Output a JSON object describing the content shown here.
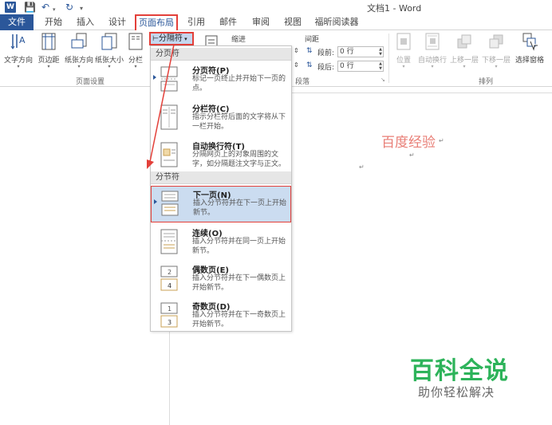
{
  "title_bar": {
    "app_logo": "W",
    "doc_title": "文档1 - Word"
  },
  "tabs": [
    "文件",
    "开始",
    "插入",
    "设计",
    "页面布局",
    "引用",
    "邮件",
    "审阅",
    "视图",
    "福昕阅读器"
  ],
  "ribbon": {
    "page_setup": {
      "buttons": [
        "文字方向",
        "页边距",
        "纸张方向",
        "纸张大小",
        "分栏"
      ],
      "group_label": "页面设置"
    },
    "breaks_button": "分隔符",
    "indent_label": "缩进",
    "spacing": {
      "label": "间距",
      "before_label": "段前:",
      "before_value": "0 行",
      "after_label": "段后:",
      "after_value": "0 行",
      "group_label": "段落"
    },
    "arrange": {
      "buttons": [
        "位置",
        "自动换行",
        "上移一层",
        "下移一层",
        "选择窗格"
      ],
      "group_label": "排列"
    }
  },
  "breaks_menu": {
    "page_breaks_header": "分页符",
    "page_breaks": [
      {
        "title": "分页符(P)",
        "desc": "标记一页终止并开始下一页的点。"
      },
      {
        "title": "分栏符(C)",
        "desc": "指示分栏符后面的文字将从下一栏开始。"
      },
      {
        "title": "自动换行符(T)",
        "desc": "分隔网页上的对象周围的文字，如分隔题注文字与正文。"
      }
    ],
    "section_breaks_header": "分节符",
    "section_breaks": [
      {
        "title": "下一页(N)",
        "desc": "插入分节符并在下一页上开始新节。"
      },
      {
        "title": "连续(O)",
        "desc": "插入分节符并在同一页上开始新节。"
      },
      {
        "title": "偶数页(E)",
        "desc": "插入分节符并在下一偶数页上开始新节。"
      },
      {
        "title": "奇数页(D)",
        "desc": "插入分节符并在下一奇数页上开始新节。"
      }
    ]
  },
  "document": {
    "heading": "百度经验"
  },
  "watermark": {
    "main": "百科全说",
    "sub": "助你轻松解决"
  },
  "colors": {
    "accent": "#2b579a",
    "highlight_border": "#e3403a",
    "watermark_green": "#2db35a",
    "heading_pink": "#e87d75"
  }
}
